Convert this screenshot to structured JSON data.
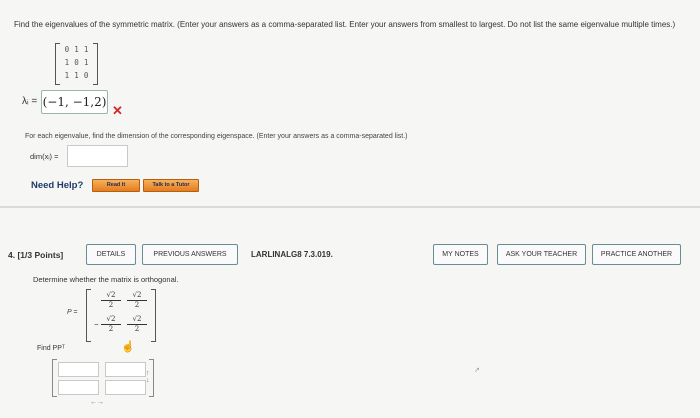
{
  "question": {
    "text": "Find the eigenvalues of the symmetric matrix. (Enter your answers as a comma-separated list. Enter your answers from smallest to largest. Do not list the same eigenvalue multiple times.)",
    "matrix": [
      [
        "0",
        "1",
        "1"
      ],
      [
        "1",
        "0",
        "1"
      ],
      [
        "1",
        "1",
        "0"
      ]
    ],
    "lambda_label": "λᵢ =",
    "answer": "(−1, −1,2)",
    "answer_status": "incorrect",
    "sub_text": "For each eigenvalue, find the dimension of the corresponding eigenspace. (Enter your answers as a comma-separated list.)",
    "dim_label": "dim(xᵢ) =",
    "dim_value": ""
  },
  "help": {
    "label": "Need Help?",
    "read_it": "Read It",
    "talk_tutor": "Talk to a Tutor"
  },
  "q4": {
    "number": "4.  [1/3 Points]",
    "buttons": {
      "details": "DETAILS",
      "previous": "PREVIOUS ANSWERS",
      "notes": "MY NOTES",
      "ask": "ASK YOUR TEACHER",
      "practice": "PRACTICE ANOTHER"
    },
    "course": "LARLINALG8 7.3.019.",
    "text": "Determine whether the matrix is orthogonal.",
    "p_label": "P =",
    "p_entries": {
      "r1c1_num": "√2",
      "r1c1_den": "2",
      "r1c2_num": "√2",
      "r1c2_den": "2",
      "r2c1_sign": "−",
      "r2c1_num": "√2",
      "r2c1_den": "2",
      "r2c2_num": "√2",
      "r2c2_den": "2"
    },
    "find_label": "Find PPᵀ"
  },
  "colors": {
    "incorrect": "#d12a2a",
    "help_text": "#1f3a68",
    "button_orange": "#e47d1f",
    "button_border": "#6a8c96"
  }
}
